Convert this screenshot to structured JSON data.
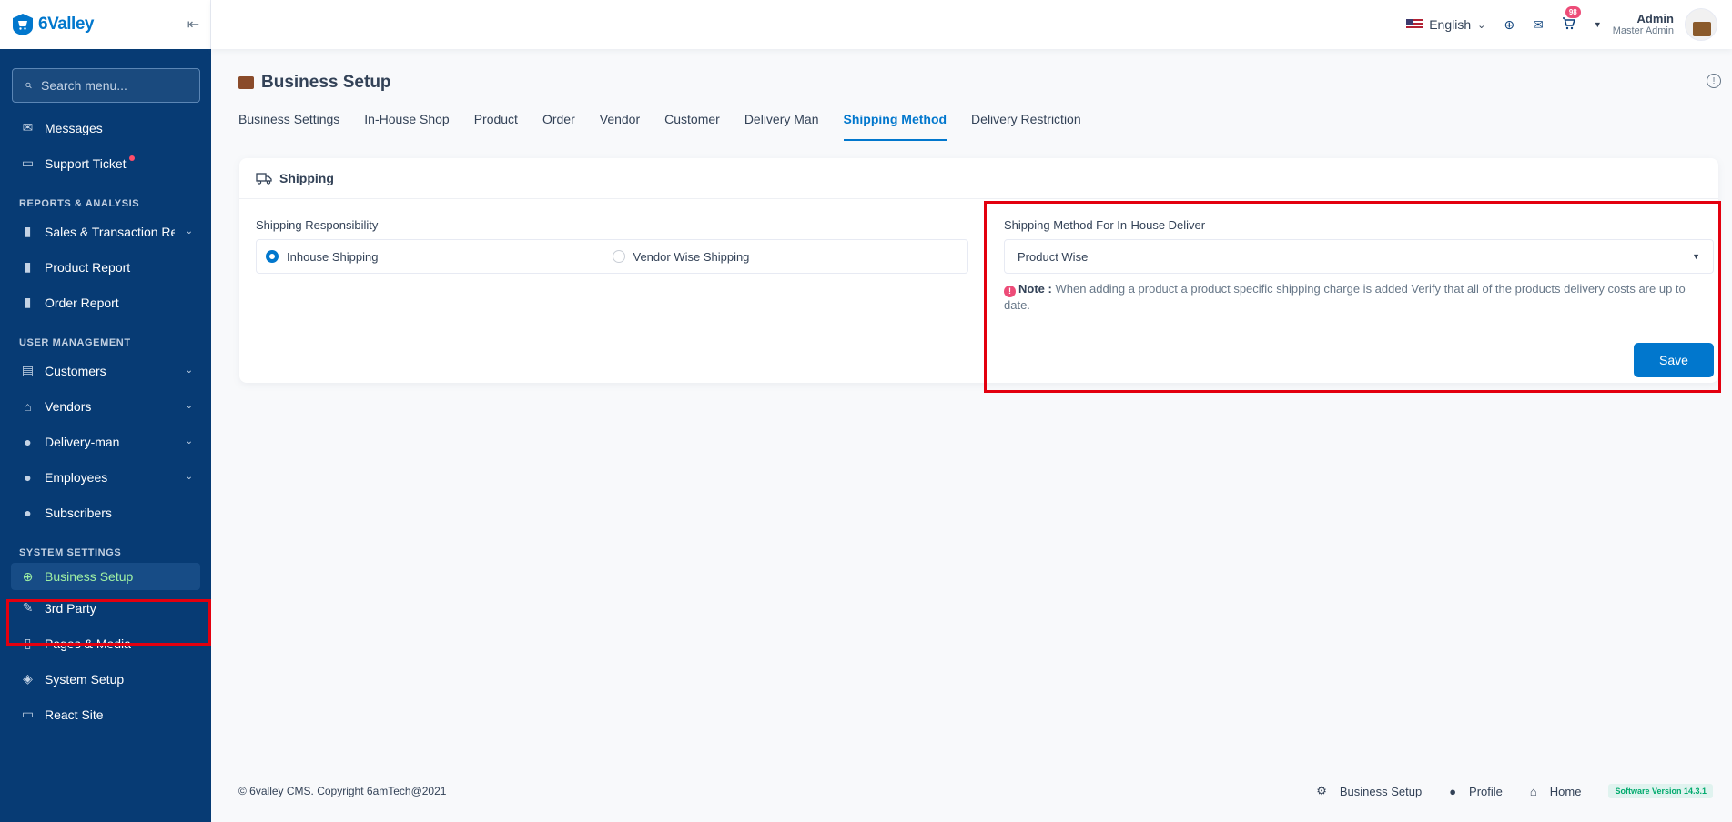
{
  "brand": {
    "name": "6Valley"
  },
  "sidebar": {
    "search_placeholder": "Search menu...",
    "items_top": [
      {
        "label": "Messages",
        "icon": "messages-icon"
      },
      {
        "label": "Support Ticket",
        "icon": "ticket-icon"
      }
    ],
    "section_reports": "REPORTS & ANALYSIS",
    "items_reports": [
      {
        "label": "Sales & Transaction Rep"
      },
      {
        "label": "Product Report"
      },
      {
        "label": "Order Report"
      }
    ],
    "section_users": "USER MANAGEMENT",
    "items_users": [
      {
        "label": "Customers"
      },
      {
        "label": "Vendors"
      },
      {
        "label": "Delivery-man"
      },
      {
        "label": "Employees"
      },
      {
        "label": "Subscribers"
      }
    ],
    "section_system": "SYSTEM SETTINGS",
    "items_system": [
      {
        "label": "Business Setup"
      },
      {
        "label": "3rd Party"
      },
      {
        "label": "Pages & Media"
      },
      {
        "label": "System Setup"
      },
      {
        "label": "React Site"
      }
    ]
  },
  "header": {
    "language": "English",
    "cart_count": "98",
    "user_name": "Admin",
    "user_role": "Master Admin"
  },
  "page": {
    "title": "Business Setup",
    "tabs": [
      "Business Settings",
      "In-House Shop",
      "Product",
      "Order",
      "Vendor",
      "Customer",
      "Delivery Man",
      "Shipping Method",
      "Delivery Restriction"
    ],
    "active_tab": "Shipping Method"
  },
  "card": {
    "title": "Shipping",
    "responsibility_label": "Shipping Responsibility",
    "option_inhouse": "Inhouse Shipping",
    "option_vendor": "Vendor Wise Shipping",
    "method_label": "Shipping Method For In-House Deliver",
    "method_value": "Product Wise",
    "note_label": "Note :",
    "note_text": "When adding a product a product specific shipping charge is added Verify that all of the products delivery costs are up to date.",
    "save_label": "Save"
  },
  "footer": {
    "copyright": "© 6valley CMS. Copyright 6amTech@2021",
    "link_business": "Business Setup",
    "link_profile": "Profile",
    "link_home": "Home",
    "version": "Software Version 14.3.1"
  },
  "colors": {
    "primary": "#0177cd",
    "sidebar": "#073b74",
    "highlight": "#e3000f",
    "active_text": "#9ff0a3"
  }
}
